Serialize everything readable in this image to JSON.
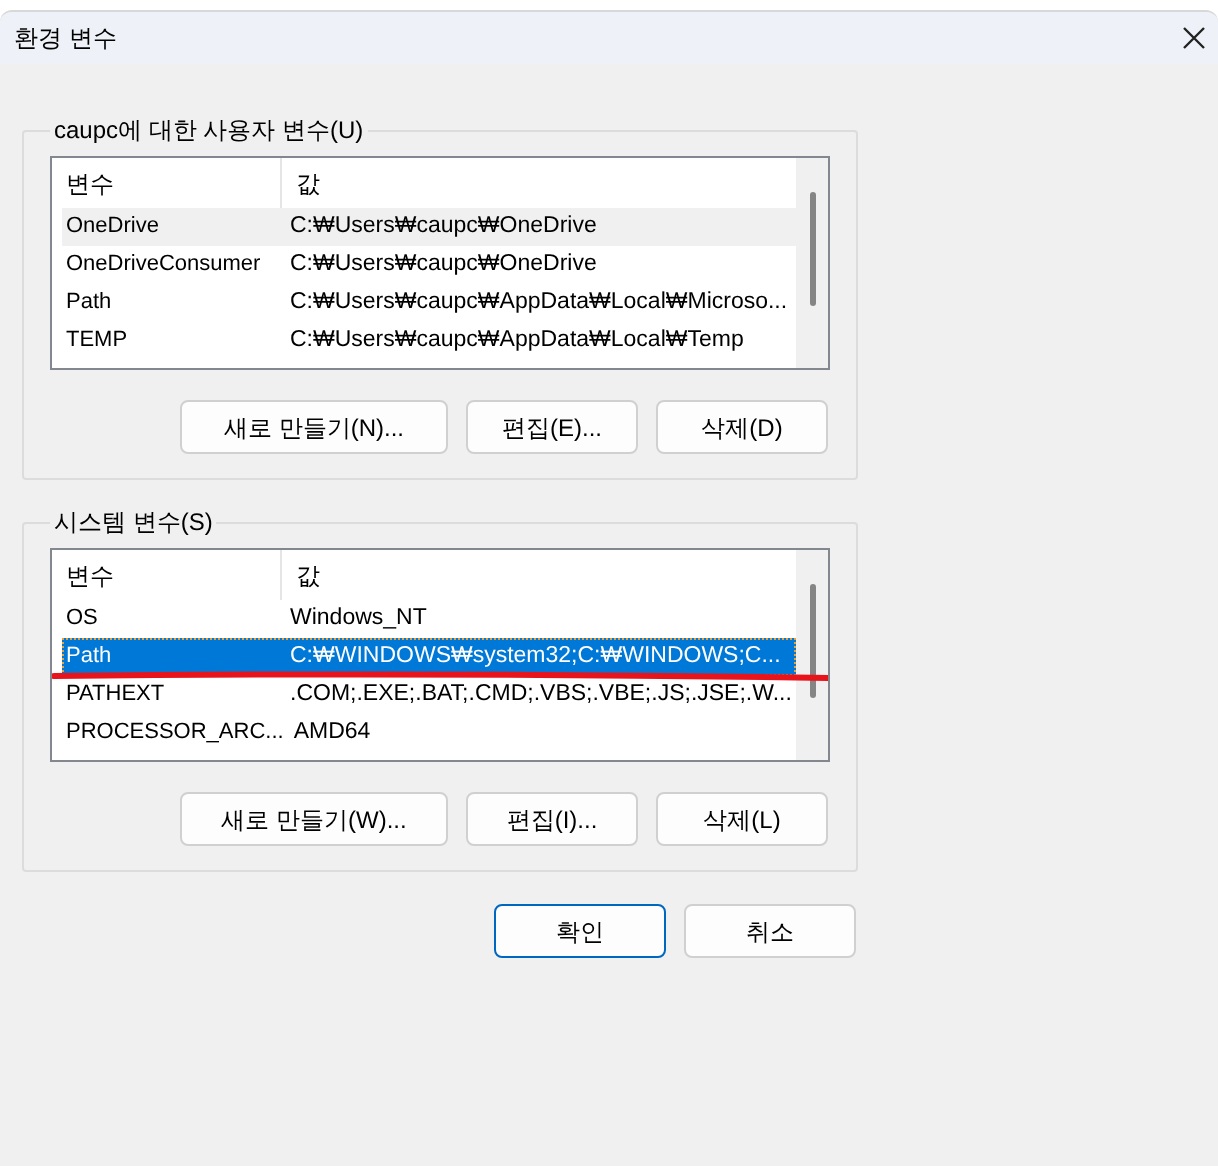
{
  "window": {
    "title": "환경 변수"
  },
  "groups": [
    {
      "title": "caupc에 대한 사용자 변수(U)",
      "focused": false,
      "columns": [
        "변수",
        "값"
      ],
      "rows": [
        {
          "name": "OneDrive",
          "value": "C:₩Users₩caupc₩OneDrive",
          "selected": true,
          "underlined": false
        },
        {
          "name": "OneDriveConsumer",
          "value": "C:₩Users₩caupc₩OneDrive",
          "selected": false,
          "underlined": false
        },
        {
          "name": "Path",
          "value": "C:₩Users₩caupc₩AppData₩Local₩Microso...",
          "selected": false,
          "underlined": false
        },
        {
          "name": "TEMP",
          "value": "C:₩Users₩caupc₩AppData₩Local₩Temp",
          "selected": false,
          "underlined": false
        }
      ],
      "buttons": [
        "새로 만들기(N)...",
        "편집(E)...",
        "삭제(D)"
      ]
    },
    {
      "title": "시스템 변수(S)",
      "focused": true,
      "columns": [
        "변수",
        "값"
      ],
      "rows": [
        {
          "name": "OS",
          "value": "Windows_NT",
          "selected": false,
          "underlined": false
        },
        {
          "name": "Path",
          "value": "C:₩WINDOWS₩system32;C:₩WINDOWS;C...",
          "selected": true,
          "underlined": true
        },
        {
          "name": "PATHEXT",
          "value": ".COM;.EXE;.BAT;.CMD;.VBS;.VBE;.JS;.JSE;.W...",
          "selected": false,
          "underlined": false
        },
        {
          "name": "PROCESSOR_ARC...",
          "value": "AMD64",
          "selected": false,
          "underlined": false
        }
      ],
      "buttons": [
        "새로 만들기(W)...",
        "편집(I)...",
        "삭제(L)"
      ]
    }
  ],
  "dialog_buttons": [
    {
      "label": "확인",
      "default": true
    },
    {
      "label": "취소",
      "default": false
    }
  ]
}
